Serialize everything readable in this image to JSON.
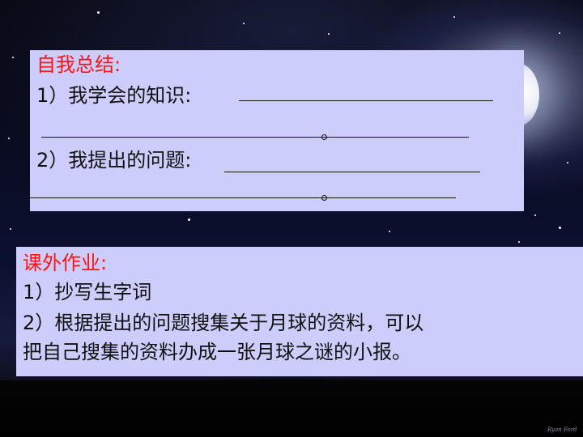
{
  "summary": {
    "title": "自我总结:",
    "item1": "1）我学会的知识:",
    "item2": "2）我提出的问题:"
  },
  "homework": {
    "title": "课外作业:",
    "item1": "1）抄写生字词",
    "item2_line1": "2）根据提出的问题搜集关于月球的资料，可以",
    "item2_line2": "把自己搜集的资料办成一张月球之谜的小报。"
  },
  "signature": "Ryan Ford",
  "colors": {
    "panel": "#cccdfb",
    "heading": "#ff1212",
    "text": "#111111"
  }
}
